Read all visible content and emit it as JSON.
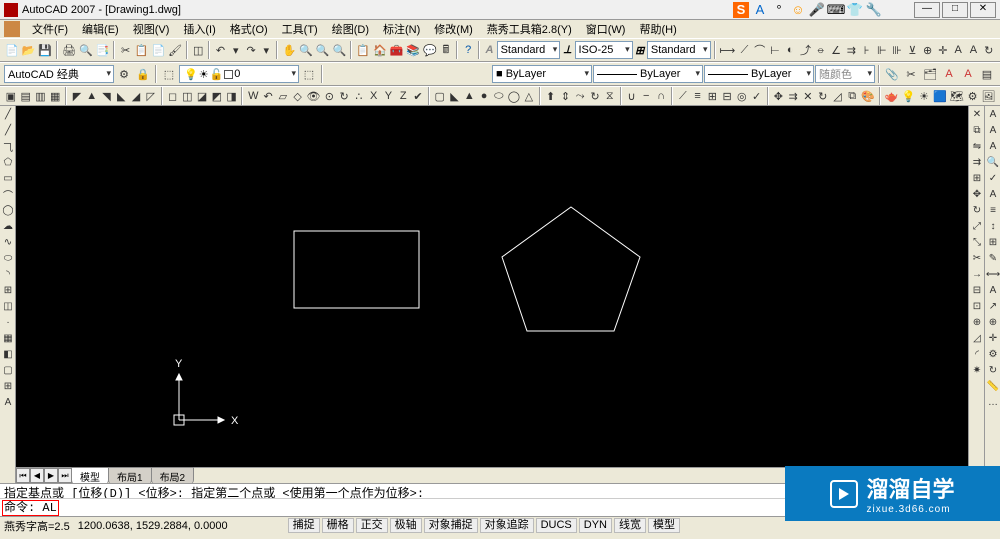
{
  "title": "AutoCAD 2007 - [Drawing1.dwg]",
  "menus": {
    "file": "文件(F)",
    "edit": "编辑(E)",
    "view": "视图(V)",
    "insert": "插入(I)",
    "format": "格式(O)",
    "tools": "工具(T)",
    "draw": "绘图(D)",
    "dimension": "标注(N)",
    "modify": "修改(M)",
    "yanxiu": "燕秀工具箱2.8(Y)",
    "window": "窗口(W)",
    "help": "帮助(H)"
  },
  "combos": {
    "workspace": "AutoCAD 经典",
    "layer": "0",
    "textstyle": "Standard",
    "dimstyle": "ISO-25",
    "tablestyle": "Standard",
    "color": "■ ByLayer",
    "linetype": "ByLayer",
    "lineweight": "ByLayer",
    "plotstyle": "随颜色"
  },
  "tabs": {
    "model": "模型",
    "layout1": "布局1",
    "layout2": "布局2"
  },
  "cmd": {
    "history": "指定基点或 [位移(D)] <位移>:  指定第二个点或 <使用第一个点作为位移>:",
    "prompt": "命令: ",
    "input": "AL"
  },
  "status": {
    "prefix": "燕秀字高=2.5",
    "coords": "1200.0638, 1529.2884, 0.0000",
    "snap": "捕捉",
    "grid": "栅格",
    "ortho": "正交",
    "polar": "极轴",
    "osnap": "对象捕捉",
    "otrack": "对象追踪",
    "ducs": "DUCS",
    "dyn": "DYN",
    "lwt": "线宽",
    "model": "模型"
  },
  "ucs": {
    "x": "X",
    "y": "Y"
  },
  "watermark": {
    "brand": "溜溜自学",
    "url": "zixue.3d66.com"
  }
}
